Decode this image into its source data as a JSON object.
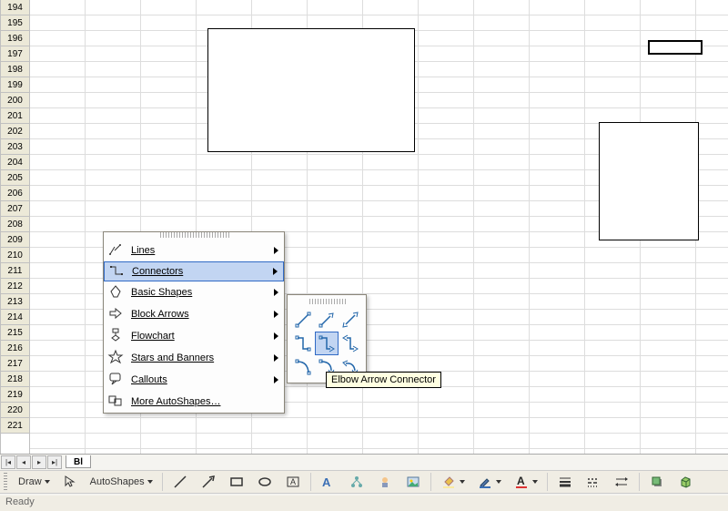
{
  "rows": [
    "194",
    "195",
    "196",
    "197",
    "198",
    "199",
    "200",
    "201",
    "202",
    "203",
    "204",
    "205",
    "206",
    "207",
    "208",
    "209",
    "210",
    "211",
    "212",
    "213",
    "214",
    "215",
    "216",
    "217",
    "218",
    "219",
    "220",
    "221"
  ],
  "sheet_tab": "Bl",
  "status": "Ready",
  "draw_toolbar": {
    "draw_label": "Draw",
    "autoshapes_label": "AutoShapes"
  },
  "autoshapes_menu": {
    "lines": "Lines",
    "connectors": "Connectors",
    "basic_shapes": "Basic Shapes",
    "block_arrows": "Block Arrows",
    "flowchart": "Flowchart",
    "stars": "Stars and Banners",
    "callouts": "Callouts",
    "more": "More AutoShapes…"
  },
  "connectors_palette": {
    "tooltip": "Elbow Arrow Connector",
    "items": [
      "straight-connector",
      "straight-arrow-connector",
      "straight-double-arrow-connector",
      "elbow-connector",
      "elbow-arrow-connector",
      "elbow-double-arrow-connector",
      "curved-connector",
      "curved-arrow-connector",
      "curved-double-arrow-connector"
    ],
    "selected_index": 4
  }
}
